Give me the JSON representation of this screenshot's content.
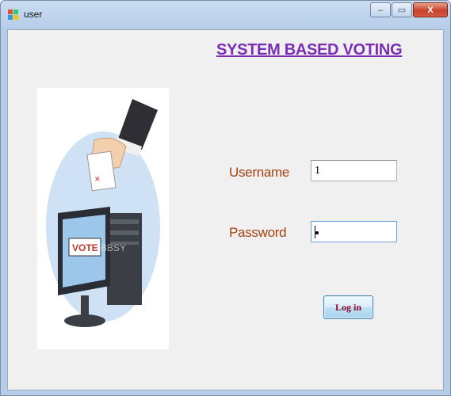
{
  "window": {
    "title": "user",
    "controls": {
      "minimize": "–",
      "maximize": "▭",
      "close": "X"
    }
  },
  "form": {
    "heading": "SYSTEM BASED VOTING",
    "username_label": "Username",
    "username_value": "1",
    "password_label": "Password",
    "password_value": "•",
    "login_label": "Log in"
  },
  "image": {
    "ballot_text": "VOTE",
    "watermark": "BBSY"
  },
  "colors": {
    "heading": "#7b2eb5",
    "labels": "#a6420f",
    "login_text": "#8a0a2a"
  }
}
